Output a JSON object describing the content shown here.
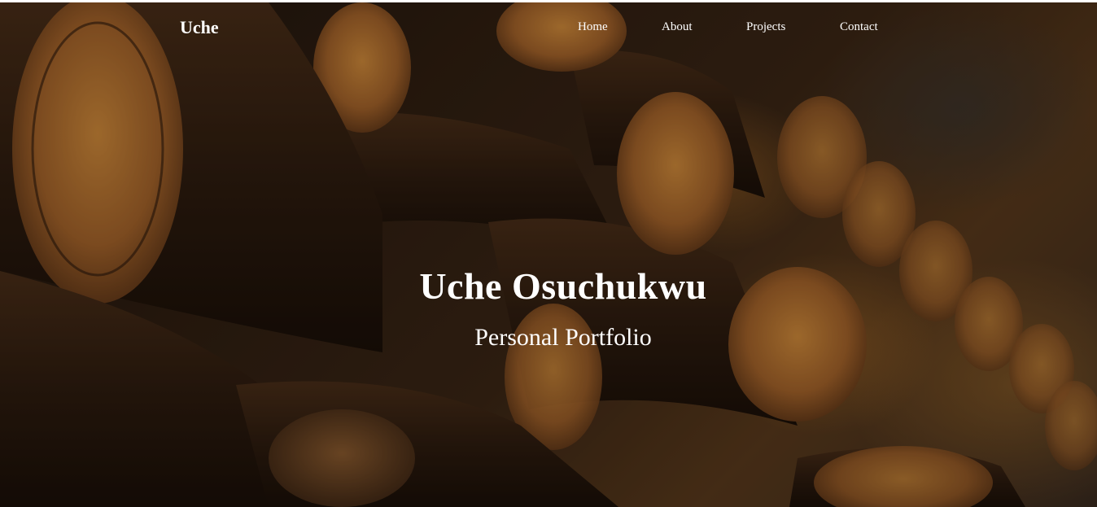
{
  "nav": {
    "brand": "Uche",
    "links": [
      {
        "label": "Home"
      },
      {
        "label": "About"
      },
      {
        "label": "Projects"
      },
      {
        "label": "Contact"
      }
    ]
  },
  "hero": {
    "title": "Uche Osuchukwu",
    "subtitle": "Personal Portfolio",
    "background_image": "wine-barrels-photo"
  },
  "colors": {
    "text": "#ffffff",
    "background_dark": "#2a1b10",
    "barrel_wood": "#3b2414",
    "barrel_head": "#b9742e"
  }
}
